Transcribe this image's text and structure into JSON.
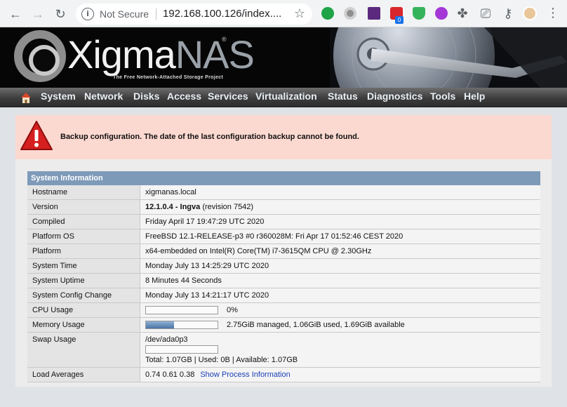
{
  "browser": {
    "security_label": "Not Secure",
    "url": "192.168.100.126/index....",
    "extension_badge": "0"
  },
  "app": {
    "logo_primary": "Xigma",
    "logo_secondary": "NAS",
    "logo_reg": "®",
    "tagline": "The Free Network-Attached Storage Project"
  },
  "menu": {
    "items": [
      "System",
      "Network",
      "Disks",
      "Access",
      "Services",
      "Virtualization",
      "Status",
      "Diagnostics",
      "Tools",
      "Help"
    ]
  },
  "alert": {
    "message": "Backup configuration. The date of the last configuration backup cannot be found."
  },
  "system_info": {
    "title": "System Information",
    "hostname": {
      "label": "Hostname",
      "value": "xigmanas.local"
    },
    "version": {
      "label": "Version",
      "value_bold": "12.1.0.4 - Ingva",
      "value_rest": " (revision 7542)"
    },
    "compiled": {
      "label": "Compiled",
      "value": "Friday April 17 19:47:29 UTC 2020"
    },
    "platform_os": {
      "label": "Platform OS",
      "value": "FreeBSD 12.1-RELEASE-p3 #0 r360028M: Fri Apr 17 01:52:46 CEST 2020"
    },
    "platform": {
      "label": "Platform",
      "value": "x64-embedded on Intel(R) Core(TM) i7-3615QM CPU @ 2.30GHz"
    },
    "system_time": {
      "label": "System Time",
      "value": "Monday July 13 14:25:29 UTC 2020"
    },
    "uptime": {
      "label": "System Uptime",
      "value": "8 Minutes 44 Seconds"
    },
    "config_change": {
      "label": "System Config Change",
      "value": "Monday July 13 14:21:17 UTC 2020"
    },
    "cpu": {
      "label": "CPU Usage",
      "value": "0%",
      "fraction": 0.0
    },
    "memory": {
      "label": "Memory Usage",
      "value": "2.75GiB managed, 1.06GiB used, 1.69GiB available",
      "fraction": 0.39
    },
    "swap": {
      "label": "Swap Usage",
      "device": "/dev/ada0p3",
      "value": "Total: 1.07GB | Used: 0B | Available: 1.07GB",
      "fraction": 0.0
    },
    "load": {
      "label": "Load Averages",
      "value": "0.74 0.61 0.38",
      "link": "Show Process Information"
    }
  },
  "colors": {
    "alert_bg": "#fcd9d0",
    "table_header": "#7e9ab9",
    "link": "#1a3fb5"
  }
}
